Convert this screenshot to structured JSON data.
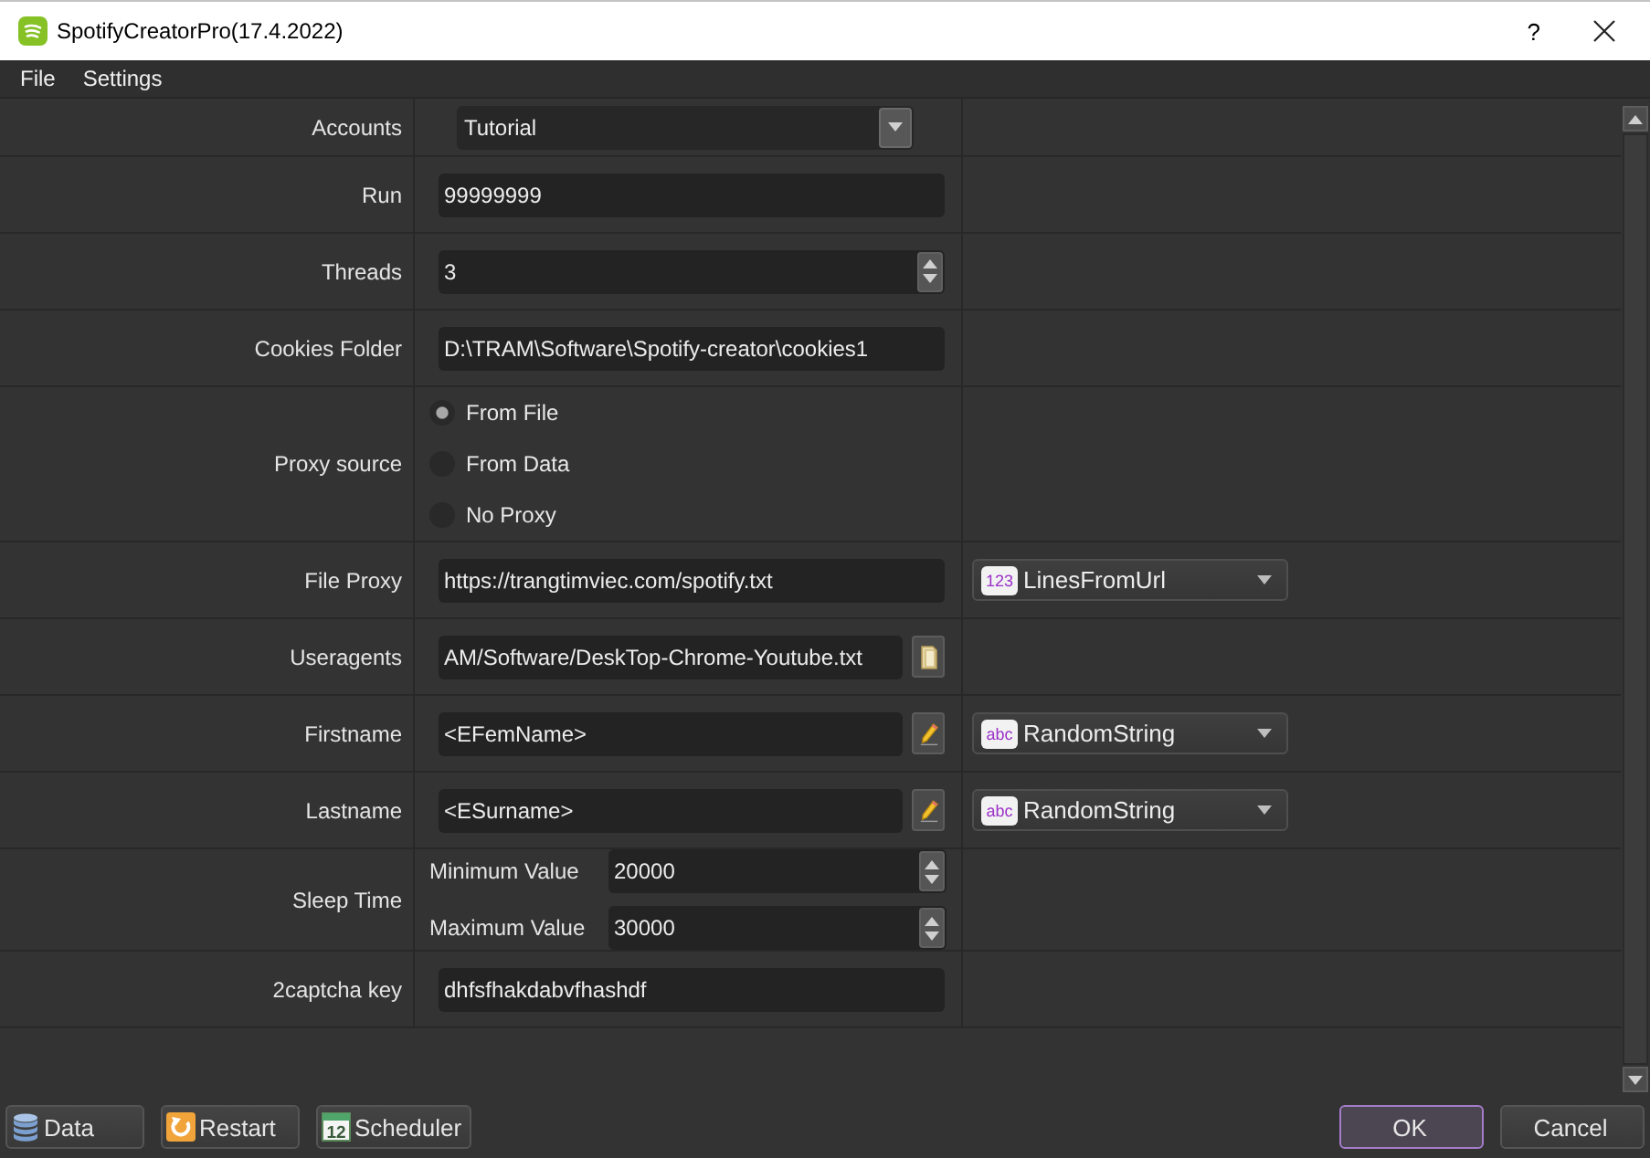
{
  "window": {
    "title": "SpotifyCreatorPro(17.4.2022)",
    "help": "?"
  },
  "menu": [
    {
      "label": "File"
    },
    {
      "label": "Settings"
    }
  ],
  "form": {
    "rows": [
      {
        "kind": "combo",
        "label": "Accounts",
        "value": "Tutorial"
      },
      {
        "kind": "text",
        "label": "Run",
        "value": "99999999"
      },
      {
        "kind": "spin",
        "label": "Threads",
        "value": "3"
      },
      {
        "kind": "text",
        "label": "Cookies Folder",
        "value": "D:\\TRAM\\Software\\Spotify-creator\\cookies1"
      },
      {
        "kind": "radio",
        "label": "Proxy source",
        "options": [
          {
            "label": "From File",
            "selected": true
          },
          {
            "label": "From Data",
            "selected": false
          },
          {
            "label": "No Proxy",
            "selected": false
          }
        ]
      },
      {
        "kind": "text",
        "label": "File Proxy",
        "value": "https://trangtimviec.com/spotify.txt",
        "source": {
          "badge": "123",
          "value": "LinesFromUrl"
        }
      },
      {
        "kind": "browse",
        "label": "Useragents",
        "value": "AM/Software/DeskTop-Chrome-Youtube.txt"
      },
      {
        "kind": "edit",
        "label": "Firstname",
        "value": "<EFemName>",
        "source": {
          "badge": "abc",
          "value": "RandomString"
        }
      },
      {
        "kind": "edit",
        "label": "Lastname",
        "value": "<ESurname>",
        "source": {
          "badge": "abc",
          "value": "RandomString"
        }
      },
      {
        "kind": "range",
        "label": "Sleep Time",
        "fields": [
          {
            "label": "Minimum Value",
            "value": "20000"
          },
          {
            "label": "Maximum Value",
            "value": "30000"
          }
        ]
      },
      {
        "kind": "text",
        "label": "2captcha key",
        "value": "dhfsfhakdabvfhashdf"
      }
    ]
  },
  "bottom_bar": {
    "left_buttons": [
      {
        "kind": "data",
        "label": "Data"
      },
      {
        "kind": "restart",
        "label": "Restart"
      },
      {
        "kind": "scheduler",
        "label": "Scheduler",
        "icon_text": "12"
      }
    ],
    "right_buttons": [
      {
        "label": "OK",
        "default": true
      },
      {
        "label": "Cancel",
        "default": false
      }
    ]
  }
}
